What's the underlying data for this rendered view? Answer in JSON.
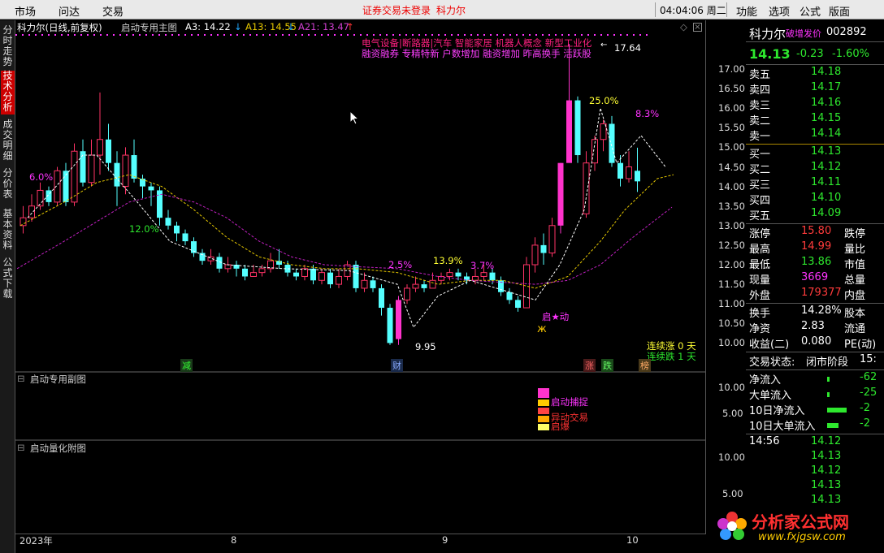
{
  "menu": {
    "left": [
      "市场",
      "问达",
      "交易"
    ],
    "center_status": "证券交易未登录",
    "center_name": "科力尔",
    "time": "04:04:06 周二",
    "right": [
      "功能",
      "选项",
      "公式",
      "版面"
    ]
  },
  "left_tabs": [
    {
      "label": "分时走势",
      "active": false
    },
    {
      "label": "技术分析",
      "active": true
    },
    {
      "label": "成交明细",
      "active": false
    },
    {
      "label": "分价表",
      "active": false
    },
    {
      "label": "基本资料",
      "active": false
    },
    {
      "label": "公式下载",
      "active": false
    }
  ],
  "main_header": {
    "title": "科力尔(日线,前复权)",
    "indicator": "启动专用主图",
    "a3": "A3: 14.22",
    "a13": "A13: 14.55",
    "a21": "A21: 13.47"
  },
  "concepts": {
    "line1": "电气设备|断路器|汽车 智能家居 机器人概念 新型工业化",
    "line2": "融资融券 专精特新 户数增加 融资增加 昨高换手 活跃股"
  },
  "price_axis": [
    "17.00",
    "16.50",
    "16.00",
    "15.50",
    "15.00",
    "14.50",
    "14.00",
    "13.50",
    "13.00",
    "12.50",
    "12.00",
    "11.50",
    "11.00",
    "10.50",
    "10.00"
  ],
  "annotations": {
    "high_price": "17.64",
    "low_price": "9.95",
    "pct1": "6.0%",
    "pct2": "12.0%",
    "pct3": "2.5%",
    "pct4": "13.9%",
    "pct5": "3.7%",
    "pct6": "25.0%",
    "pct7": "8.3%",
    "start_label": "启★动",
    "up_streak": "连续涨 0  天",
    "down_streak": "连续跌 1  天",
    "markers": [
      "减",
      "财",
      "涨",
      "跌",
      "榜"
    ]
  },
  "sub1": {
    "title": "启动专用副图",
    "axis": [
      "10.00",
      "5.00"
    ],
    "labels": [
      "启动捕捉",
      "异动交易",
      "启爆"
    ]
  },
  "sub2": {
    "title": "启动量化附图",
    "axis": [
      "10.00",
      "5.00"
    ]
  },
  "time_axis": [
    "2023年",
    "8",
    "9",
    "10"
  ],
  "quote": {
    "name": "科力尔",
    "tag": "破增发价",
    "code": "002892",
    "price": "14.13",
    "change": "-0.23",
    "pct": "-1.60%",
    "sells": [
      {
        "label": "卖五",
        "price": "14.18"
      },
      {
        "label": "卖四",
        "price": "14.17"
      },
      {
        "label": "卖三",
        "price": "14.16"
      },
      {
        "label": "卖二",
        "price": "14.15"
      },
      {
        "label": "卖一",
        "price": "14.14"
      }
    ],
    "buys": [
      {
        "label": "买一",
        "price": "14.13"
      },
      {
        "label": "买二",
        "price": "14.12"
      },
      {
        "label": "买三",
        "price": "14.11"
      },
      {
        "label": "买四",
        "price": "14.10"
      },
      {
        "label": "买五",
        "price": "14.09"
      }
    ],
    "stats": [
      {
        "l": "涨停",
        "v": "15.80",
        "r": "跌停",
        "c": "red"
      },
      {
        "l": "最高",
        "v": "14.99",
        "r": "量比",
        "c": "red"
      },
      {
        "l": "最低",
        "v": "13.86",
        "r": "市值",
        "c": "green"
      },
      {
        "l": "现量",
        "v": "3669",
        "r": "总量",
        "c": "magenta"
      },
      {
        "l": "外盘",
        "v": "179377",
        "r": "内盘",
        "c": "red"
      }
    ],
    "stats2": [
      {
        "l": "换手",
        "v": "14.28%",
        "r": "股本"
      },
      {
        "l": "净资",
        "v": "2.83",
        "r": "流通"
      },
      {
        "l": "收益(二)",
        "v": "0.080",
        "r": "PE(动)"
      }
    ],
    "trade_state_label": "交易状态:",
    "trade_state_value": "闭市阶段",
    "trade_state_num": "15:",
    "flows": [
      {
        "l": "净流入",
        "v": "-62"
      },
      {
        "l": "大单流入",
        "v": "-25"
      },
      {
        "l": "10日净流入",
        "v": "-2"
      },
      {
        "l": "10日大单流入",
        "v": "-2"
      }
    ],
    "ticks_time": "14:56",
    "ticks": [
      "14.12",
      "14.13",
      "14.12",
      "14.13",
      "14.13",
      "14.13"
    ]
  },
  "logo": {
    "text": "分析家公式网",
    "url": "www.fxjgsw.com"
  },
  "colors": {
    "up": "#ff3366",
    "down": "#55ffff",
    "ma_yellow": "#e6c800",
    "ma_magenta": "#c020c0",
    "pink": "#ff33cc"
  }
}
